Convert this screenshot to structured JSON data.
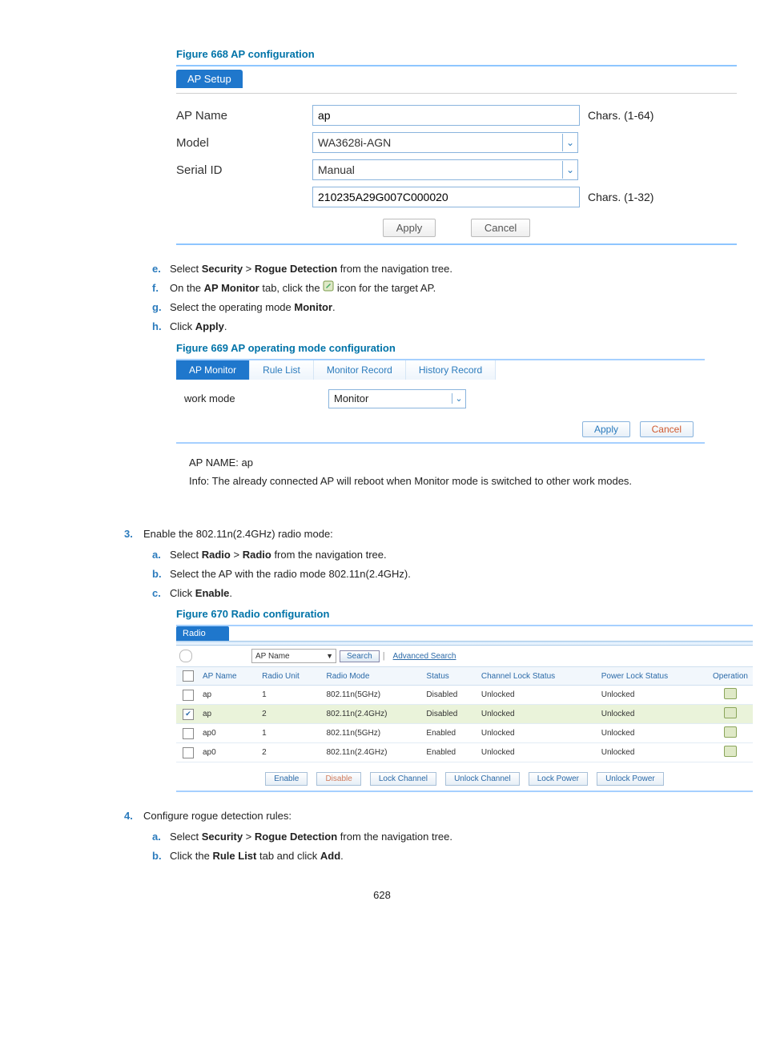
{
  "fig668": {
    "caption": "Figure 668 AP configuration",
    "tab": "AP Setup",
    "rows": {
      "ap_name_label": "AP Name",
      "ap_name_value": "ap",
      "ap_name_hint": "Chars. (1-64)",
      "model_label": "Model",
      "model_value": "WA3628i-AGN",
      "serial_label": "Serial ID",
      "serial_mode": "Manual",
      "serial_value": "210235A29G007C000020",
      "serial_hint": "Chars. (1-32)"
    },
    "buttons": {
      "apply": "Apply",
      "cancel": "Cancel"
    }
  },
  "steps_e_h": {
    "e": {
      "prefix": "Select ",
      "b1": "Security",
      "mid": " > ",
      "b2": "Rogue Detection",
      "suffix": " from the navigation tree."
    },
    "f": {
      "prefix": "On the ",
      "b1": "AP Monitor",
      "mid": " tab, click the ",
      "suffix": " icon for the target AP."
    },
    "g": {
      "prefix": "Select the operating mode ",
      "b1": "Monitor",
      "suffix": "."
    },
    "h": {
      "prefix": "Click ",
      "b1": "Apply",
      "suffix": "."
    }
  },
  "fig669": {
    "caption": "Figure 669 AP operating mode configuration",
    "tabs": [
      "AP Monitor",
      "Rule List",
      "Monitor Record",
      "History Record"
    ],
    "active_tab": 0,
    "workmode_label": "work mode",
    "workmode_value": "Monitor",
    "buttons": {
      "apply": "Apply",
      "cancel": "Cancel"
    },
    "footer_line1": "AP NAME: ap",
    "footer_line2": "Info: The already connected AP will reboot when Monitor mode is switched to other work modes."
  },
  "step3": {
    "num": "3.",
    "text": "Enable the 802.11n(2.4GHz) radio mode:",
    "a": {
      "prefix": "Select ",
      "b1": "Radio",
      "mid": " > ",
      "b2": "Radio",
      "suffix": " from the navigation tree."
    },
    "b_text": "Select the AP with the radio mode 802.11n(2.4GHz).",
    "c": {
      "prefix": "Click ",
      "b1": "Enable",
      "suffix": "."
    }
  },
  "fig670": {
    "caption": "Figure 670 Radio configuration",
    "tab": "Radio",
    "search": {
      "field_label": "AP Name",
      "search_btn": "Search",
      "advanced": "Advanced Search"
    },
    "headers": [
      "",
      "AP Name",
      "Radio Unit",
      "Radio Mode",
      "Status",
      "Channel Lock Status",
      "Power Lock Status",
      "Operation"
    ],
    "rows": [
      {
        "checked": false,
        "ap": "ap",
        "unit": "1",
        "mode": "802.11n(5GHz)",
        "status": "Disabled",
        "ch": "Unlocked",
        "pw": "Unlocked"
      },
      {
        "checked": true,
        "ap": "ap",
        "unit": "2",
        "mode": "802.11n(2.4GHz)",
        "status": "Disabled",
        "ch": "Unlocked",
        "pw": "Unlocked"
      },
      {
        "checked": false,
        "ap": "ap0",
        "unit": "1",
        "mode": "802.11n(5GHz)",
        "status": "Enabled",
        "ch": "Unlocked",
        "pw": "Unlocked"
      },
      {
        "checked": false,
        "ap": "ap0",
        "unit": "2",
        "mode": "802.11n(2.4GHz)",
        "status": "Enabled",
        "ch": "Unlocked",
        "pw": "Unlocked"
      }
    ],
    "buttons": [
      "Enable",
      "Disable",
      "Lock Channel",
      "Unlock Channel",
      "Lock Power",
      "Unlock Power"
    ]
  },
  "step4": {
    "num": "4.",
    "text": "Configure rogue detection rules:",
    "a": {
      "prefix": "Select ",
      "b1": "Security",
      "mid": " > ",
      "b2": "Rogue Detection",
      "suffix": " from the navigation tree."
    },
    "b": {
      "prefix": "Click the ",
      "b1": "Rule List",
      "mid": " tab and click ",
      "b2": "Add",
      "suffix": "."
    }
  },
  "page_number": "628"
}
